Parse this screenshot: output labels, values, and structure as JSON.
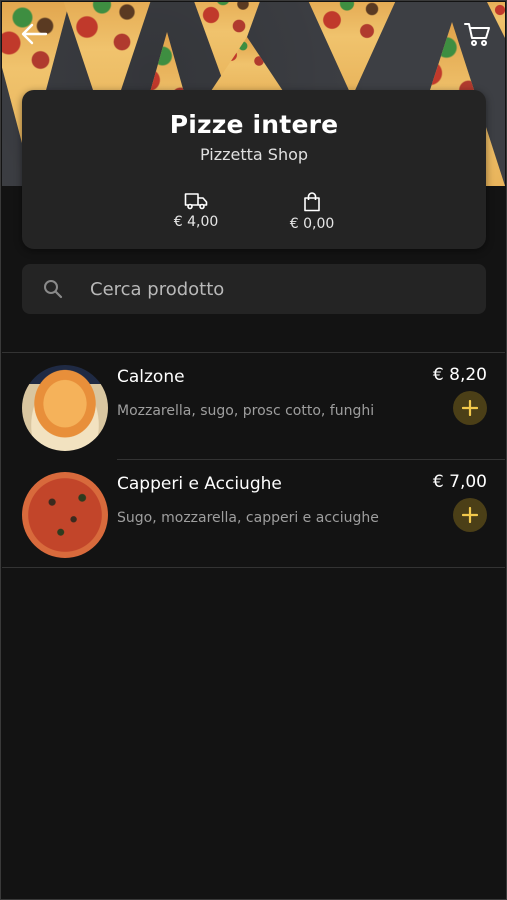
{
  "shop": {
    "title": "Pizze intere",
    "subtitle": "Pizzetta Shop",
    "delivery_cost": "€ 4,00",
    "min_order": "€ 0,00"
  },
  "search": {
    "placeholder": "Cerca prodotto",
    "value": ""
  },
  "products": [
    {
      "name": "Calzone",
      "description": "Mozzarella, sugo, prosc cotto, funghi",
      "price": "€ 8,20"
    },
    {
      "name": "Capperi e Acciughe",
      "description": "Sugo, mozzarella, capperi e acciughe",
      "price": "€ 7,00"
    }
  ],
  "icons": {
    "back": "arrow-left-icon",
    "cart": "cart-icon",
    "delivery": "truck-icon",
    "bag": "shopping-bag-icon",
    "search": "search-icon",
    "add": "plus-icon"
  },
  "colors": {
    "background": "#131313",
    "card": "#242424",
    "accent": "#f2c94c",
    "add_button_bg": "#4b3f17"
  }
}
